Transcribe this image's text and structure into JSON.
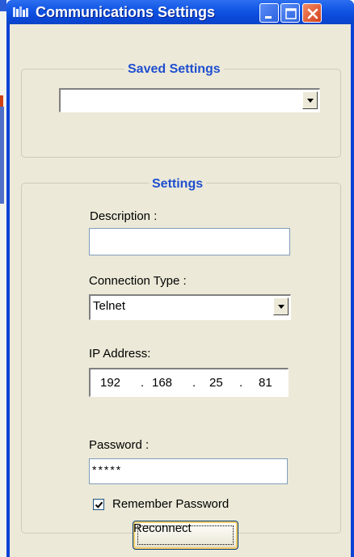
{
  "window": {
    "title": "Communications Settings",
    "title_color": "#ffffff",
    "titlebar_color": "#0a42d6",
    "client_color": "#ece9d8",
    "accent_color": "#1f4fcf"
  },
  "titlebar_buttons": {
    "minimize_icon": "minimize-icon",
    "maximize_icon": "maximize-icon",
    "close_icon": "close-icon"
  },
  "saved_settings": {
    "group_title": "Saved Settings",
    "selected_value": ""
  },
  "settings": {
    "group_title": "Settings",
    "description_label": "Description :",
    "description_value": "",
    "connection_type_label": "Connection Type :",
    "connection_type_value": "Telnet",
    "ip_address_label": "IP Address:",
    "ip_address": [
      "192",
      "168",
      "25",
      "81"
    ],
    "ip_separator": ".",
    "password_label": "Password :",
    "password_value": "*****",
    "remember_password_label": "Remember Password",
    "remember_password_checked": true
  },
  "actions": {
    "reconnect_label": "Reconnect"
  }
}
